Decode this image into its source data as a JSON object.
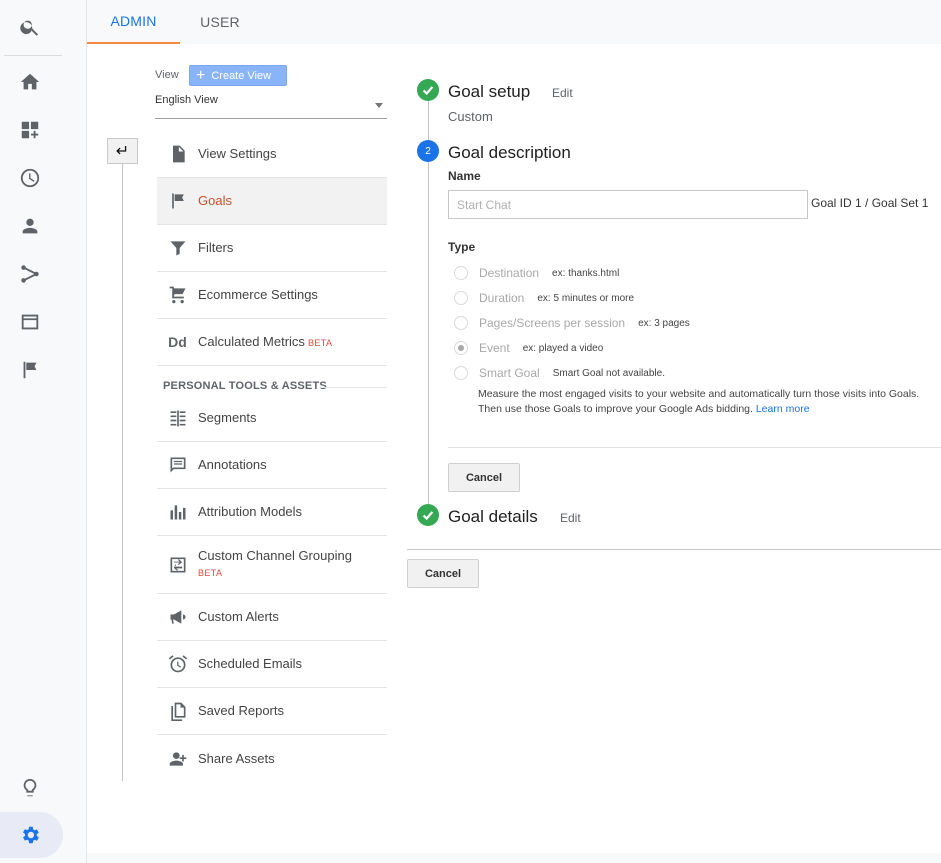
{
  "tabs": {
    "admin": "ADMIN",
    "user": "USER"
  },
  "view_header": {
    "label": "View",
    "create_view": "Create View",
    "selected_view": "English View"
  },
  "nav_items": [
    {
      "label": "View Settings"
    },
    {
      "label": "Goals",
      "active": true
    },
    {
      "label": "Filters"
    },
    {
      "label": "Ecommerce Settings"
    },
    {
      "label": "Calculated Metrics",
      "badge": "BETA"
    }
  ],
  "personal_section": {
    "title": "PERSONAL TOOLS & ASSETS",
    "items": [
      {
        "label": "Segments"
      },
      {
        "label": "Annotations"
      },
      {
        "label": "Attribution Models"
      },
      {
        "label": "Custom Channel Grouping",
        "badge": "BETA"
      },
      {
        "label": "Custom Alerts"
      },
      {
        "label": "Scheduled Emails"
      },
      {
        "label": "Saved Reports"
      },
      {
        "label": "Share Assets"
      }
    ]
  },
  "goal_setup": {
    "title": "Goal setup",
    "edit": "Edit",
    "value": "Custom"
  },
  "goal_description": {
    "step_number": "2",
    "title": "Goal description",
    "name_label": "Name",
    "name_placeholder": "Start Chat",
    "goal_id": "Goal ID 1 / Goal Set 1",
    "type_label": "Type",
    "types": [
      {
        "label": "Destination",
        "example": "ex: thanks.html",
        "checked": false
      },
      {
        "label": "Duration",
        "example": "ex: 5 minutes or more",
        "checked": false
      },
      {
        "label": "Pages/Screens per session",
        "example": "ex: 3 pages",
        "checked": false
      },
      {
        "label": "Event",
        "example": "ex: played a video",
        "checked": true
      },
      {
        "label": "Smart Goal",
        "example": "Smart Goal not available.",
        "checked": false
      }
    ],
    "smart_goal_desc": "Measure the most engaged visits to your website and automatically turn those visits into Goals. Then use those Goals to improve your Google Ads bidding.",
    "learn_more": "Learn more",
    "cancel": "Cancel"
  },
  "goal_details": {
    "title": "Goal details",
    "edit": "Edit"
  },
  "footer": {
    "cancel": "Cancel"
  },
  "colors": {
    "accent": "#1a73e8",
    "active_nav": "#c5502b",
    "success": "#34a853",
    "beta": "#e8453c",
    "tab_underline": "#f48b3f"
  }
}
